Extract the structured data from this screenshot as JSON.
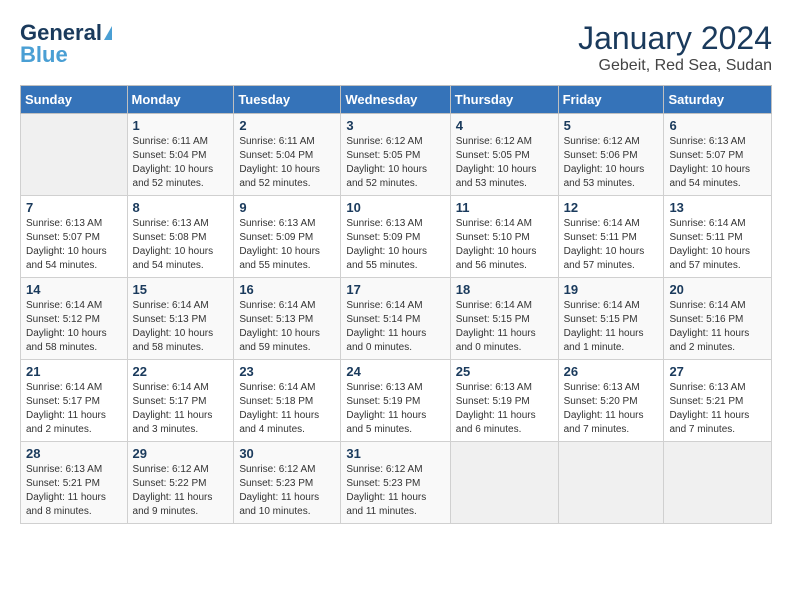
{
  "logo": {
    "part1": "General",
    "part2": "Blue"
  },
  "title": "January 2024",
  "subtitle": "Gebeit, Red Sea, Sudan",
  "days_of_week": [
    "Sunday",
    "Monday",
    "Tuesday",
    "Wednesday",
    "Thursday",
    "Friday",
    "Saturday"
  ],
  "weeks": [
    [
      {
        "day": "",
        "detail": ""
      },
      {
        "day": "1",
        "detail": "Sunrise: 6:11 AM\nSunset: 5:04 PM\nDaylight: 10 hours\nand 52 minutes."
      },
      {
        "day": "2",
        "detail": "Sunrise: 6:11 AM\nSunset: 5:04 PM\nDaylight: 10 hours\nand 52 minutes."
      },
      {
        "day": "3",
        "detail": "Sunrise: 6:12 AM\nSunset: 5:05 PM\nDaylight: 10 hours\nand 52 minutes."
      },
      {
        "day": "4",
        "detail": "Sunrise: 6:12 AM\nSunset: 5:05 PM\nDaylight: 10 hours\nand 53 minutes."
      },
      {
        "day": "5",
        "detail": "Sunrise: 6:12 AM\nSunset: 5:06 PM\nDaylight: 10 hours\nand 53 minutes."
      },
      {
        "day": "6",
        "detail": "Sunrise: 6:13 AM\nSunset: 5:07 PM\nDaylight: 10 hours\nand 54 minutes."
      }
    ],
    [
      {
        "day": "7",
        "detail": "Sunrise: 6:13 AM\nSunset: 5:07 PM\nDaylight: 10 hours\nand 54 minutes."
      },
      {
        "day": "8",
        "detail": "Sunrise: 6:13 AM\nSunset: 5:08 PM\nDaylight: 10 hours\nand 54 minutes."
      },
      {
        "day": "9",
        "detail": "Sunrise: 6:13 AM\nSunset: 5:09 PM\nDaylight: 10 hours\nand 55 minutes."
      },
      {
        "day": "10",
        "detail": "Sunrise: 6:13 AM\nSunset: 5:09 PM\nDaylight: 10 hours\nand 55 minutes."
      },
      {
        "day": "11",
        "detail": "Sunrise: 6:14 AM\nSunset: 5:10 PM\nDaylight: 10 hours\nand 56 minutes."
      },
      {
        "day": "12",
        "detail": "Sunrise: 6:14 AM\nSunset: 5:11 PM\nDaylight: 10 hours\nand 57 minutes."
      },
      {
        "day": "13",
        "detail": "Sunrise: 6:14 AM\nSunset: 5:11 PM\nDaylight: 10 hours\nand 57 minutes."
      }
    ],
    [
      {
        "day": "14",
        "detail": "Sunrise: 6:14 AM\nSunset: 5:12 PM\nDaylight: 10 hours\nand 58 minutes."
      },
      {
        "day": "15",
        "detail": "Sunrise: 6:14 AM\nSunset: 5:13 PM\nDaylight: 10 hours\nand 58 minutes."
      },
      {
        "day": "16",
        "detail": "Sunrise: 6:14 AM\nSunset: 5:13 PM\nDaylight: 10 hours\nand 59 minutes."
      },
      {
        "day": "17",
        "detail": "Sunrise: 6:14 AM\nSunset: 5:14 PM\nDaylight: 11 hours\nand 0 minutes."
      },
      {
        "day": "18",
        "detail": "Sunrise: 6:14 AM\nSunset: 5:15 PM\nDaylight: 11 hours\nand 0 minutes."
      },
      {
        "day": "19",
        "detail": "Sunrise: 6:14 AM\nSunset: 5:15 PM\nDaylight: 11 hours\nand 1 minute."
      },
      {
        "day": "20",
        "detail": "Sunrise: 6:14 AM\nSunset: 5:16 PM\nDaylight: 11 hours\nand 2 minutes."
      }
    ],
    [
      {
        "day": "21",
        "detail": "Sunrise: 6:14 AM\nSunset: 5:17 PM\nDaylight: 11 hours\nand 2 minutes."
      },
      {
        "day": "22",
        "detail": "Sunrise: 6:14 AM\nSunset: 5:17 PM\nDaylight: 11 hours\nand 3 minutes."
      },
      {
        "day": "23",
        "detail": "Sunrise: 6:14 AM\nSunset: 5:18 PM\nDaylight: 11 hours\nand 4 minutes."
      },
      {
        "day": "24",
        "detail": "Sunrise: 6:13 AM\nSunset: 5:19 PM\nDaylight: 11 hours\nand 5 minutes."
      },
      {
        "day": "25",
        "detail": "Sunrise: 6:13 AM\nSunset: 5:19 PM\nDaylight: 11 hours\nand 6 minutes."
      },
      {
        "day": "26",
        "detail": "Sunrise: 6:13 AM\nSunset: 5:20 PM\nDaylight: 11 hours\nand 7 minutes."
      },
      {
        "day": "27",
        "detail": "Sunrise: 6:13 AM\nSunset: 5:21 PM\nDaylight: 11 hours\nand 7 minutes."
      }
    ],
    [
      {
        "day": "28",
        "detail": "Sunrise: 6:13 AM\nSunset: 5:21 PM\nDaylight: 11 hours\nand 8 minutes."
      },
      {
        "day": "29",
        "detail": "Sunrise: 6:12 AM\nSunset: 5:22 PM\nDaylight: 11 hours\nand 9 minutes."
      },
      {
        "day": "30",
        "detail": "Sunrise: 6:12 AM\nSunset: 5:23 PM\nDaylight: 11 hours\nand 10 minutes."
      },
      {
        "day": "31",
        "detail": "Sunrise: 6:12 AM\nSunset: 5:23 PM\nDaylight: 11 hours\nand 11 minutes."
      },
      {
        "day": "",
        "detail": ""
      },
      {
        "day": "",
        "detail": ""
      },
      {
        "day": "",
        "detail": ""
      }
    ]
  ]
}
